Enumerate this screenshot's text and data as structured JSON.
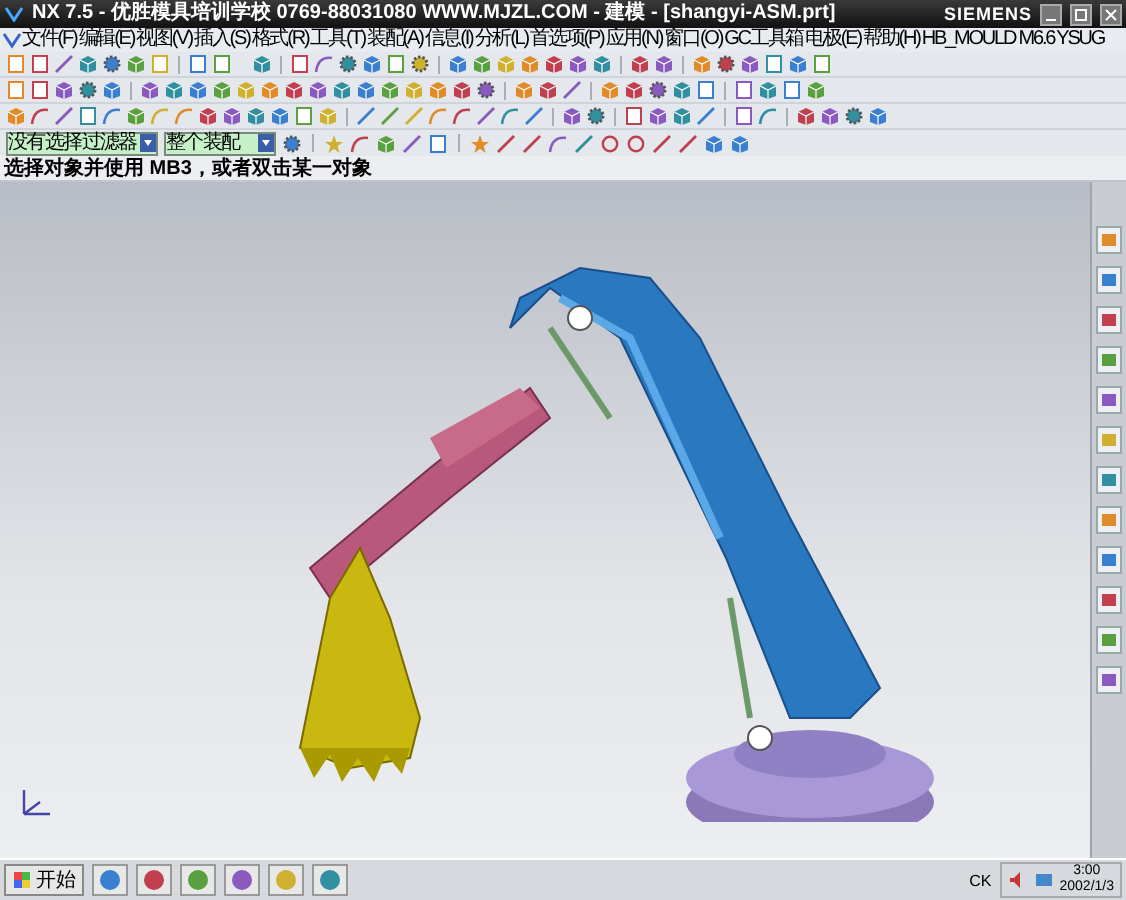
{
  "window": {
    "title": "NX 7.5 - 优胜模具培训学校 0769-88031080 WWW.MJZL.COM - 建模 - [shangyi-ASM.prt]",
    "brand": "SIEMENS"
  },
  "menu": [
    "文件(F)",
    "编辑(E)",
    "视图(V)",
    "插入(S)",
    "格式(R)",
    "工具(T)",
    "装配(A)",
    "信息(I)",
    "分析(L)",
    "首选项(P)",
    "应用(N)",
    "窗口(O)",
    "GC工具箱",
    "电极(E)",
    "帮助(H)",
    "HB_MOULD M6.6",
    "YSUG"
  ],
  "selection_bar": {
    "filters": [
      "没有选择过滤器",
      "整个装配"
    ]
  },
  "status_bar": {
    "prompt": "选择对象并使用 MB3，或者双击某一对象"
  },
  "taskbar": {
    "start": "开始",
    "tray_text": "CK",
    "time": "3:00",
    "date": "2002/1/3"
  }
}
